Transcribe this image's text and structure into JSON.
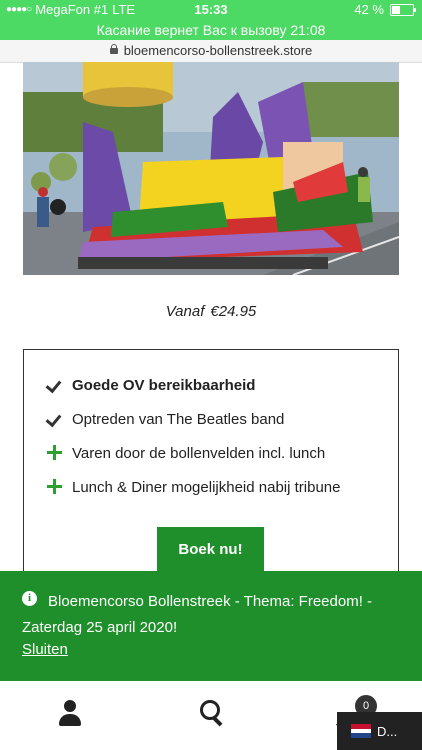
{
  "status_bar": {
    "carrier": "MegaFon #1",
    "network": "LTE",
    "time": "15:33",
    "battery_percent": "42 %",
    "battery_level": 0.42
  },
  "call_bar": {
    "text": "Касание вернет Вас к вызову 21:08"
  },
  "browser": {
    "url": "bloemencorso-bollenstreek.store"
  },
  "product": {
    "price_prefix": "Vanaf",
    "price": "€24.95",
    "features": [
      {
        "icon": "check-icon",
        "text": "Goede OV bereikbaarheid",
        "bold": true
      },
      {
        "icon": "check-icon",
        "text": "Optreden van The Beatles band",
        "bold": false
      },
      {
        "icon": "plus-icon",
        "text": "Varen door de bollenvelden incl. lunch",
        "bold": false
      },
      {
        "icon": "plus-icon",
        "text": "Lunch & Diner mogelijkheid nabij tribune",
        "bold": false
      }
    ],
    "book_label": "Boek nu!"
  },
  "notice": {
    "icon": "info-icon",
    "message": "Bloemencorso Bollenstreek - Thema: Freedom! - Zaterdag 25 april 2020!",
    "close_label": "Sluiten"
  },
  "bottom_nav": {
    "icons": [
      "user-icon",
      "search-icon",
      "cart-icon"
    ],
    "cart_count": "0",
    "language_label": "D..."
  },
  "colors": {
    "status_green": "#4cd964",
    "brand_green": "#1e8f2a",
    "plus_green": "#2e9e2e"
  }
}
